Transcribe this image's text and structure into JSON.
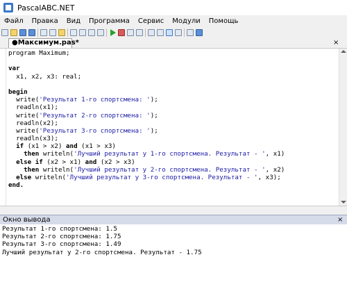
{
  "window": {
    "title": "PascalABC.NET"
  },
  "menu": [
    "Файл",
    "Правка",
    "Вид",
    "Программа",
    "Сервис",
    "Модули",
    "Помощь"
  ],
  "tab": {
    "label": "●Максимум.pas*",
    "close_glyph": "×"
  },
  "code": [
    [
      {
        "t": "program Maximum;",
        "c": ""
      }
    ],
    [
      {
        "t": "",
        "c": ""
      }
    ],
    [
      {
        "t": "var",
        "c": "kw"
      }
    ],
    [
      {
        "t": "  x1, x2, x3: real;",
        "c": ""
      }
    ],
    [
      {
        "t": "",
        "c": ""
      }
    ],
    [
      {
        "t": "begin",
        "c": "kw"
      }
    ],
    [
      {
        "t": "  write(",
        "c": ""
      },
      {
        "t": "'Результат 1-го спортсмена: '",
        "c": "str"
      },
      {
        "t": ");",
        "c": ""
      }
    ],
    [
      {
        "t": "  readln(x1);",
        "c": ""
      }
    ],
    [
      {
        "t": "  write(",
        "c": ""
      },
      {
        "t": "'Результат 2-го спортсмена: '",
        "c": "str"
      },
      {
        "t": ");",
        "c": ""
      }
    ],
    [
      {
        "t": "  readln(x2);",
        "c": ""
      }
    ],
    [
      {
        "t": "  write(",
        "c": ""
      },
      {
        "t": "'Результат 3-го спортсмена: '",
        "c": "str"
      },
      {
        "t": ");",
        "c": ""
      }
    ],
    [
      {
        "t": "  readln(x3);",
        "c": ""
      }
    ],
    [
      {
        "t": "  ",
        "c": ""
      },
      {
        "t": "if",
        "c": "kw"
      },
      {
        "t": " (x1 > x2) ",
        "c": ""
      },
      {
        "t": "and",
        "c": "kw"
      },
      {
        "t": " (x1 > x3)",
        "c": ""
      }
    ],
    [
      {
        "t": "    ",
        "c": ""
      },
      {
        "t": "then",
        "c": "kw"
      },
      {
        "t": " writeln(",
        "c": ""
      },
      {
        "t": "'Лучший результат у 1-го спортсмена. Результат - '",
        "c": "str"
      },
      {
        "t": ", x1)",
        "c": ""
      }
    ],
    [
      {
        "t": "  ",
        "c": ""
      },
      {
        "t": "else if",
        "c": "kw"
      },
      {
        "t": " (x2 > x1) ",
        "c": ""
      },
      {
        "t": "and",
        "c": "kw"
      },
      {
        "t": " (x2 > x3)",
        "c": ""
      }
    ],
    [
      {
        "t": "    ",
        "c": ""
      },
      {
        "t": "then",
        "c": "kw"
      },
      {
        "t": " writeln(",
        "c": ""
      },
      {
        "t": "'Лучший результат у 2-го спортсмена. Результат - '",
        "c": "str"
      },
      {
        "t": ", x2)",
        "c": ""
      }
    ],
    [
      {
        "t": "  ",
        "c": ""
      },
      {
        "t": "else",
        "c": "kw"
      },
      {
        "t": " writeln(",
        "c": ""
      },
      {
        "t": "'Лучший результат у 3-го спортсмена. Результат - '",
        "c": "str"
      },
      {
        "t": ", x3);",
        "c": ""
      }
    ],
    [
      {
        "t": "end.",
        "c": "kw"
      }
    ]
  ],
  "output_panel": {
    "label": "Окно вывода",
    "close_glyph": "×",
    "text": "Результат 1-го спортсмена: 1.5\nРезультат 2-го спортсмена: 1.75\nРезультат 3-го спортсмена: 1.49\nЛучший результат у 2-го спортсмена. Результат - 1.75"
  },
  "icons": [
    "new-file-icon",
    "open-folder-icon",
    "save-icon",
    "save-all-icon",
    "cut-icon",
    "copy-icon",
    "paste-icon",
    "undo-icon",
    "redo-icon",
    "find-icon",
    "replace-icon",
    "run-icon",
    "stop-icon",
    "compile-icon",
    "debug-icon",
    "step-into-icon",
    "step-over-icon",
    "toggle-output-icon",
    "format-icon",
    "settings-icon",
    "help-icon"
  ]
}
